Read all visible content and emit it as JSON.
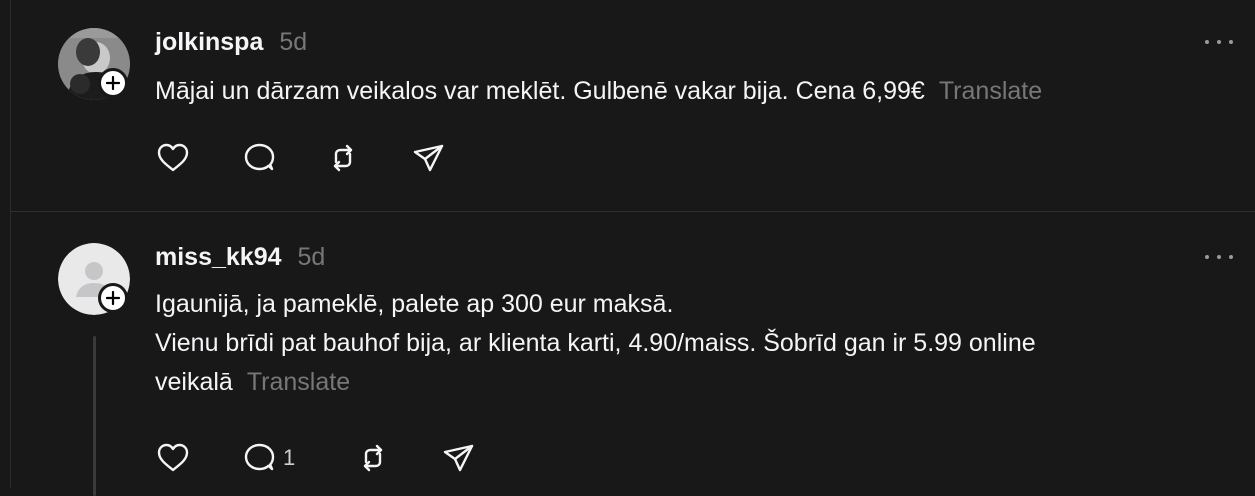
{
  "posts": [
    {
      "username": "jolkinspa",
      "time": "5d",
      "lines": [
        "Mājai un dārzam veikalos var meklēt. Gulbenē vakar bija. Cena 6,99€"
      ],
      "translate": "Translate",
      "reply_count": ""
    },
    {
      "username": "miss_kk94",
      "time": "5d",
      "lines": [
        "Igaunijā, ja pameklē, palete ap 300 eur maksā.",
        "Vienu brīdi pat bauhof bija, ar klienta karti, 4.90/maiss. Šobrīd gan ir 5.99 online",
        "veikalā"
      ],
      "translate": "Translate",
      "reply_count": "1"
    }
  ],
  "icons": {
    "like": "heart-icon",
    "reply": "comment-icon",
    "repost": "repost-icon",
    "share": "share-icon",
    "more": "more-options-icon",
    "follow": "plus-icon"
  },
  "colors": {
    "background": "#181818",
    "text": "#f3f5f7",
    "muted": "#777777",
    "divider": "#2f2f2f"
  }
}
